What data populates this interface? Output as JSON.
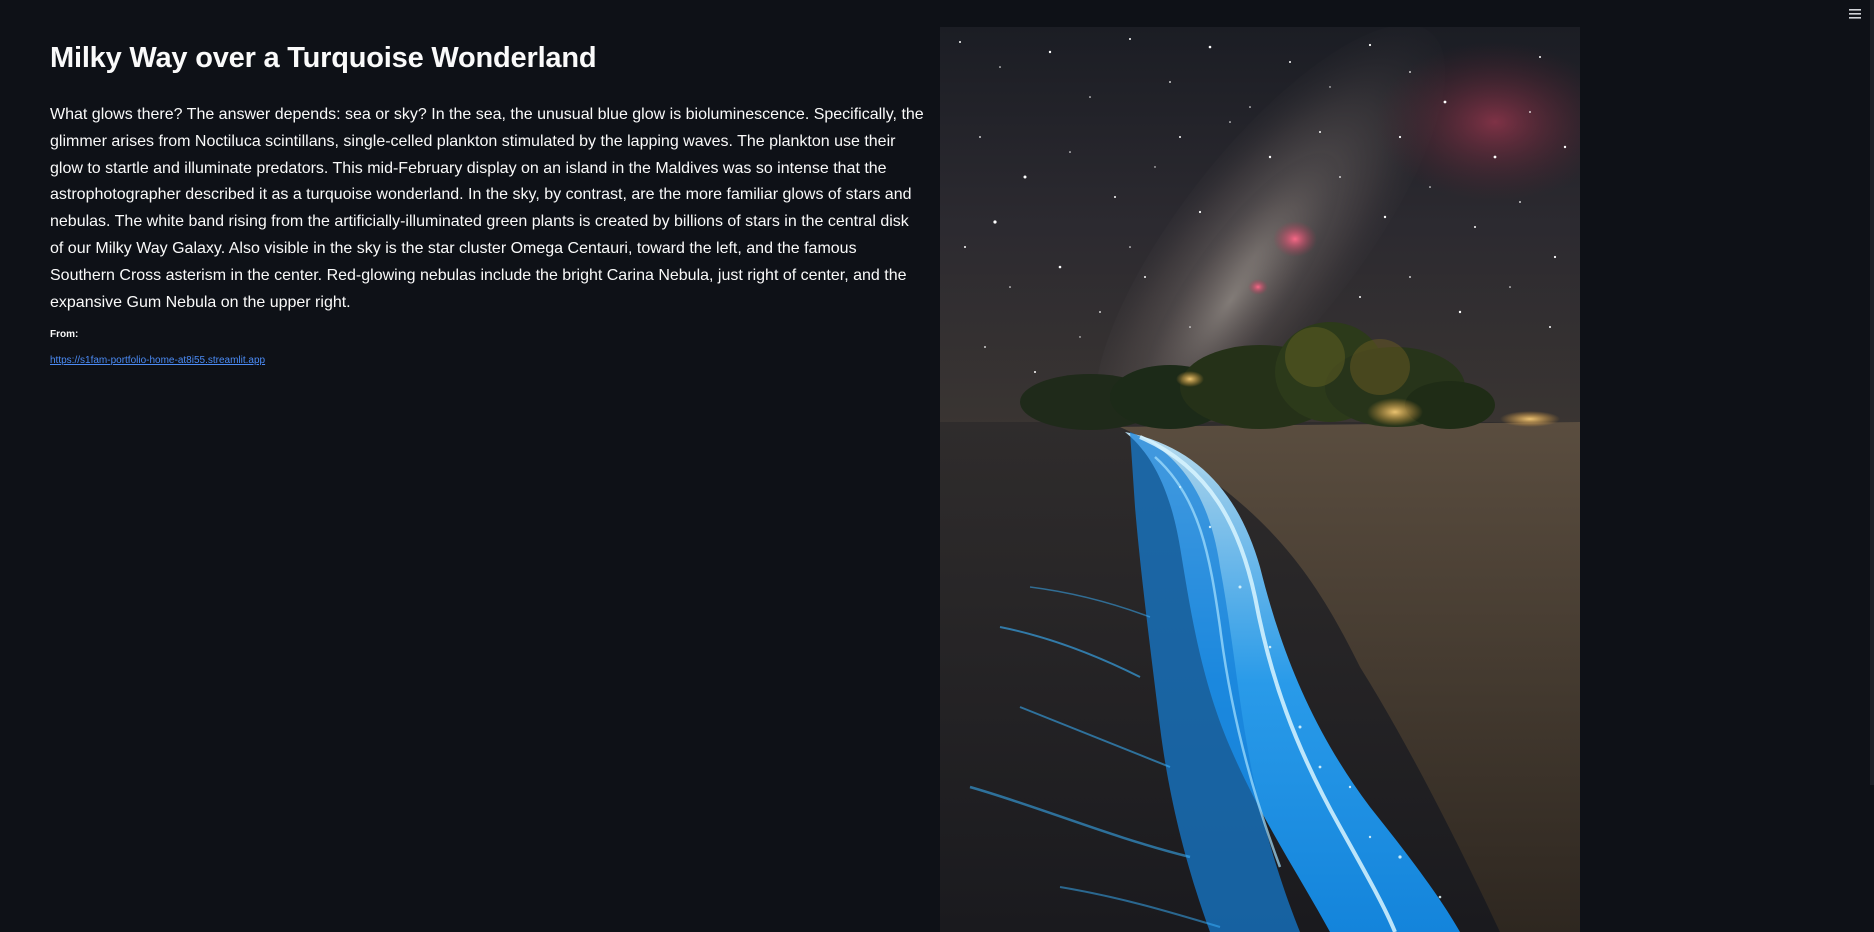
{
  "app": {
    "menu_icon": "hamburger-menu-icon"
  },
  "article": {
    "title": "Milky Way over a Turquoise Wonderland",
    "description": "What glows there? The answer depends: sea or sky? In the sea, the unusual blue glow is bioluminescence. Specifically, the glimmer arises from Noctiluca scintillans, single-celled plankton stimulated by the lapping waves. The plankton use their glow to startle and illuminate predators. This mid-February display on an island in the Maldives was so intense that the astrophotographer described it as a turquoise wonderland. In the sky, by contrast, are the more familiar glows of stars and nebulas. The white band rising from the artificially-illuminated green plants is created by billions of stars in the central disk of our Milky Way Galaxy. Also visible in the sky is the star cluster Omega Centauri, toward the left, and the famous Southern Cross asterism in the center. Red-glowing nebulas include the bright Carina Nebula, just right of center, and the expansive Gum Nebula on the upper right.",
    "from_label": "From:",
    "source_link": "https://s1fam-portfolio-home-at8i55.streamlit.app"
  },
  "colors": {
    "background": "#0e1117",
    "text": "#fafafa",
    "link": "#4b8bf5",
    "glow": "#1fa8ff"
  }
}
